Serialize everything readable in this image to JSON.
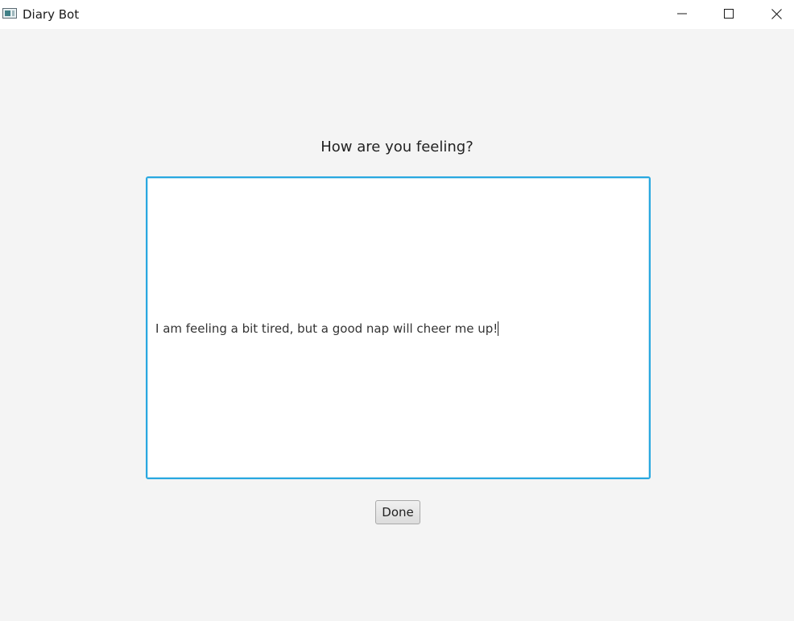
{
  "window": {
    "title": "Diary Bot",
    "app_icon": "window-app-icon",
    "controls": {
      "minimize_icon": "minimize-icon",
      "maximize_icon": "maximize-icon",
      "close_icon": "close-icon"
    }
  },
  "main": {
    "prompt": "How are you feeling?",
    "entry": {
      "value": "I am feeling a bit tired, but a good nap will cheer me up!",
      "focused": true
    },
    "done_label": "Done"
  },
  "colors": {
    "focus_border": "#29a8e0",
    "background": "#f4f4f4"
  }
}
